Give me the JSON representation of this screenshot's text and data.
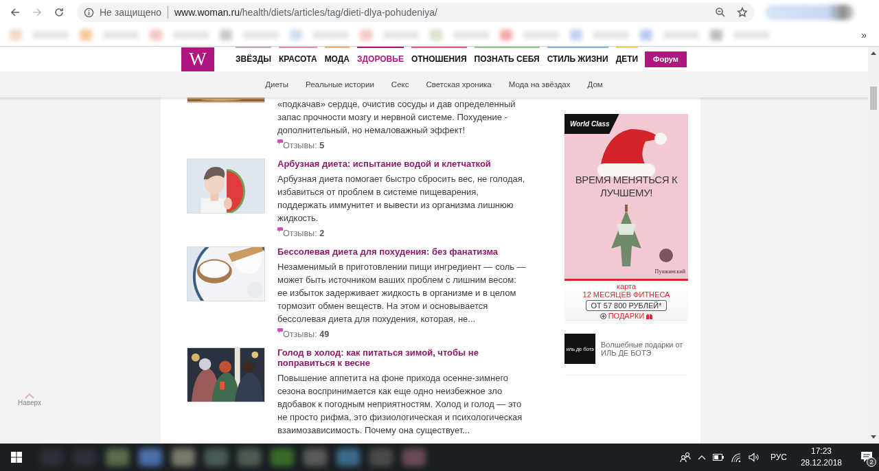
{
  "browser": {
    "forward_disabled": true,
    "security_label": "Не защищено",
    "url_host": "www.woman.ru",
    "url_path": "/health/diets/articles/tag/dieti-dlya-pohudeniya/",
    "bookmarks_more": "»"
  },
  "site": {
    "logo": "W",
    "nav": [
      {
        "label": "ЗВЁЗДЫ",
        "selected": false,
        "color": "#c7a3d6"
      },
      {
        "label": "КРАСОТА",
        "selected": false,
        "color": "#e68bb8"
      },
      {
        "label": "МОДА",
        "selected": false,
        "color": "#f2b36b"
      },
      {
        "label": "ЗДОРОВЬЕ",
        "selected": true,
        "color": "#b0177e"
      },
      {
        "label": "ОТНОШЕНИЯ",
        "selected": false,
        "color": "#e05a8a"
      },
      {
        "label": "ПОЗНАТЬ СЕБЯ",
        "selected": false,
        "color": "#8fc98a"
      },
      {
        "label": "СТИЛЬ ЖИЗНИ",
        "selected": false,
        "color": "#7fb7e0"
      },
      {
        "label": "ДЕТИ",
        "selected": false,
        "color": "#f0d56a"
      }
    ],
    "forum_button": "Форум",
    "subnav": [
      "Диеты",
      "Реальные истории",
      "Секс",
      "Светская хроника",
      "Мода на звёздах",
      "Дом"
    ]
  },
  "partial_article": {
    "excerpt": "«подкачав» сердце, очистив сосуды и дав определенный запас прочности мозгу и нервной системе. Похудение - дополнительный, но немаловажный эффект!",
    "reviews": "Отзывы: **5**"
  },
  "articles": [
    {
      "kind": "picture",
      "title": "Арбузная диета: испытание водой и клетчаткой",
      "excerpt": "Арбузная диета помогает быстро сбросить вес, не голодая, избавиться от проблем в системе пищеварения, поддержать иммунитет и вывести из организма лишнюю жидкость.",
      "reviews": "Отзывы: **2**"
    },
    {
      "kind": "picture",
      "title": "Бессолевая диета для похудения: без фанатизма",
      "excerpt": "Незаменимый в приготовлении пищи ингредиент — соль — может быть источником ваших проблем с лишним весом: ее избыток задерживает жидкость в организме и в целом тормозит обмен веществ. На этом и основывается бессолевая диета для похудения, которая, не...",
      "reviews": "Отзывы: **49**"
    },
    {
      "kind": "picture",
      "title": "Голод в холод: как питаться зимой, чтобы не поправиться к весне",
      "excerpt": "Повышение аппетита на фоне прихода осенне-зимнего сезона воспринимается как еще одно неизбежное зло вдобавок к погодным неприятностям. Холод и голод — это не просто рифма, это физиологическая и психологическая взаимозависимость. Почему она существует..."
    }
  ],
  "ad": {
    "brand": "World Class",
    "headline": "ВРЕМЯ МЕНЯТЬСЯ К ЛУЧШЕМУ!",
    "partner": "Пушкинский",
    "card": "карта",
    "offer": "12 МЕСЯЦЕВ ФИТНЕСА",
    "price": "ОТ 57 800 РУБЛЕЙ*",
    "gifts": "ПОДАРКИ"
  },
  "promo": {
    "logo": "иль де ботэ",
    "text": "Волшебные подарки от ИЛЬ ДЕ БОТЭ"
  },
  "back_to_top": "Наверх",
  "taskbar": {
    "language": "РУС",
    "time": "17:23",
    "date": "28.12.2018",
    "notifications": "2"
  }
}
